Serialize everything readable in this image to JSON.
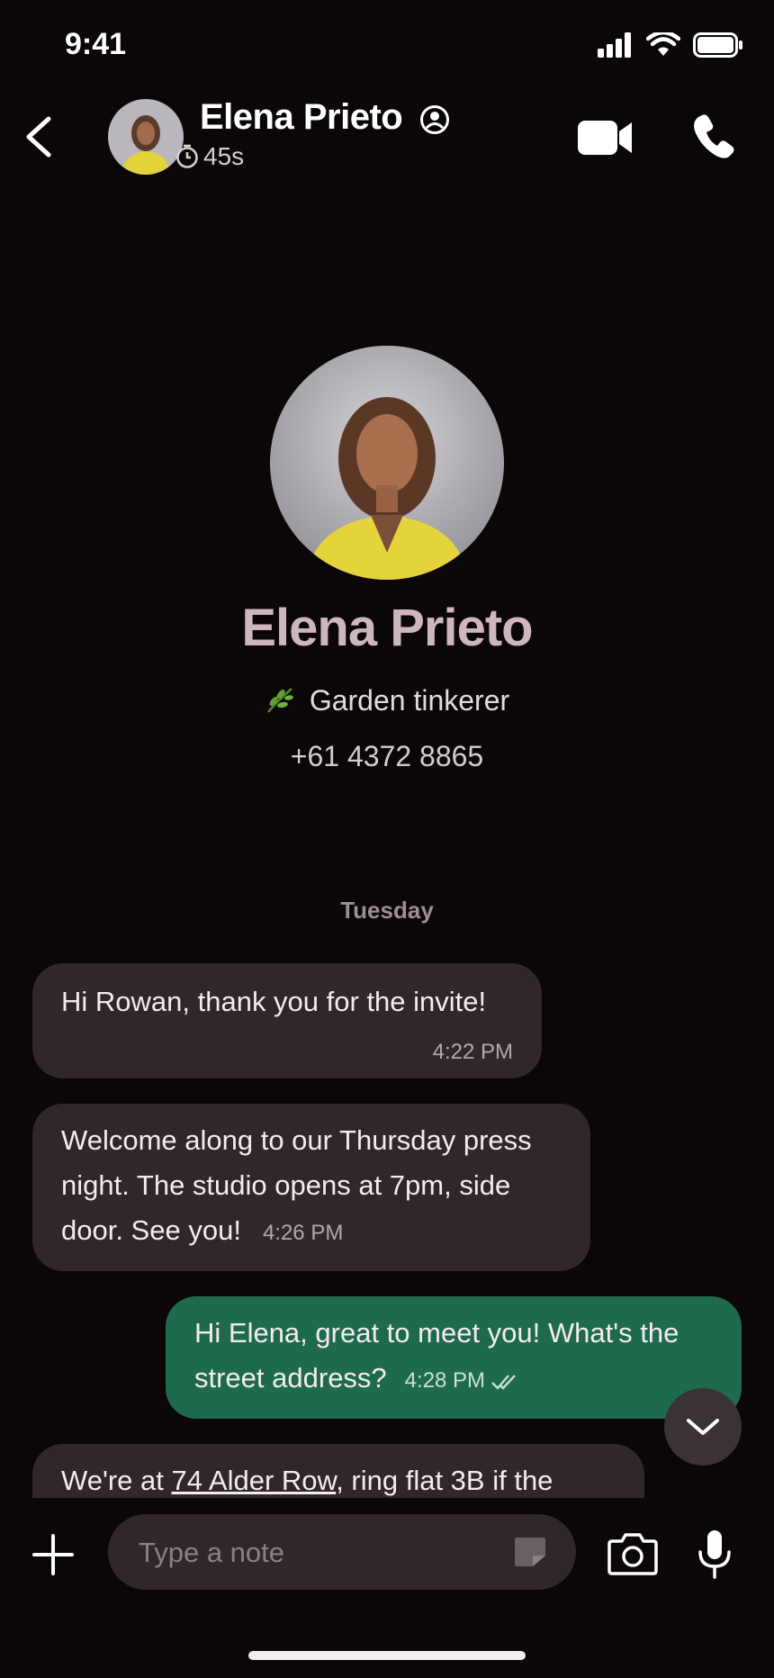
{
  "status_bar": {
    "time": "9:41",
    "icons": [
      "signal-icon",
      "wifi-icon",
      "battery-icon"
    ]
  },
  "header": {
    "contact_name": "Elena Prieto",
    "timer": "45s",
    "icons": [
      "back-icon",
      "profile-icon",
      "timer-icon",
      "video-icon",
      "phone-icon"
    ]
  },
  "profile": {
    "name": "Elena Prieto",
    "bio": "Garden tinkerer",
    "bio_emoji": "leaf-icon",
    "phone": "+61 4372 8865"
  },
  "chat": {
    "day_label": "Tuesday",
    "messages": [
      {
        "direction": "incoming",
        "text": "Hi Rowan, thank you for the invite!",
        "time": "4:22 PM"
      },
      {
        "direction": "incoming",
        "text": "Welcome along to our Thursday press night. The studio opens at 7pm, side door. See you!",
        "time": "4:26 PM"
      },
      {
        "direction": "outgoing",
        "text": "Hi Elena, great to meet you! What's the street address?",
        "time": "4:28 PM",
        "status": "read"
      },
      {
        "direction": "incoming",
        "text_before": "We're at ",
        "link": "74 Alder Row",
        "text_after": ", ring flat 3B if the"
      }
    ]
  },
  "composer": {
    "placeholder": "Type a note"
  },
  "colors": {
    "background": "#0b0607",
    "incoming_bubble": "#2f2729",
    "outgoing_bubble": "#1e6a4d",
    "name_accent": "#cdb6bc"
  }
}
